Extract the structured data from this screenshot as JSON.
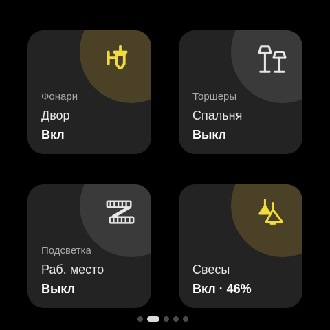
{
  "tiles": [
    {
      "category": "Фонари",
      "room": "Двор",
      "status": "Вкл",
      "state": "on",
      "icon": "street-lantern-icon"
    },
    {
      "category": "Торшеры",
      "room": "Спальня",
      "status": "Выкл",
      "state": "off",
      "icon": "floor-lamps-icon"
    },
    {
      "category": "Подсветка",
      "room": "Раб. место",
      "status": "Выкл",
      "state": "off",
      "icon": "led-strip-icon"
    },
    {
      "category": "",
      "room": "Свесы",
      "status": "Вкл · 46%",
      "state": "on",
      "brightness_percent": 46,
      "icon": "pendant-lamps-icon"
    }
  ],
  "pager": {
    "page_count": 5,
    "current_page": 2
  },
  "colors": {
    "accent_on": "#f2dc3a",
    "icon_off": "#e6e6e6",
    "tile_bg": "#232323",
    "blob_on": "#4a4127",
    "blob_off": "#3a3a3a",
    "background": "#000000"
  }
}
